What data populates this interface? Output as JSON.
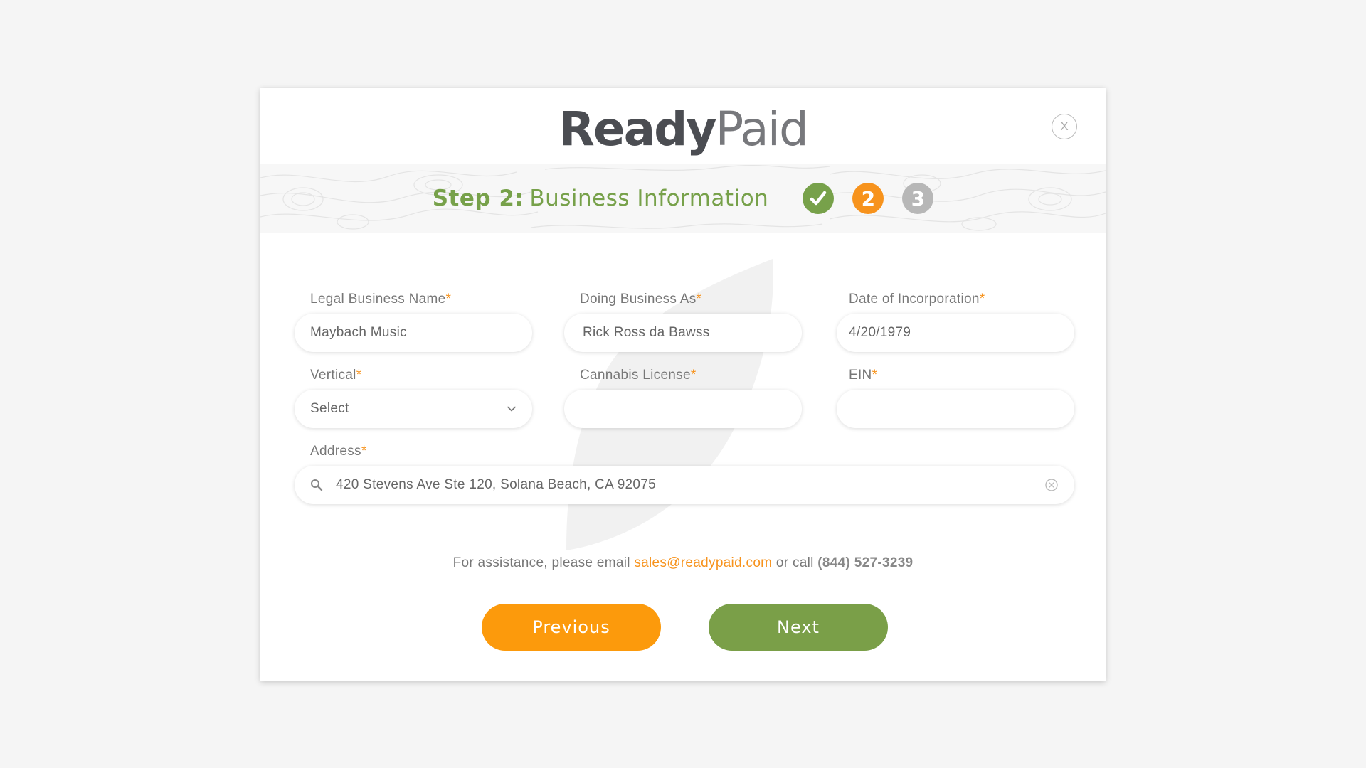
{
  "brand": {
    "word1": "Ready",
    "word2": "Paid"
  },
  "close_label": "X",
  "step": {
    "prefix": "Step 2:",
    "title": "Business Information",
    "indicators": [
      {
        "label": "",
        "state": "done",
        "icon": "check-icon"
      },
      {
        "label": "2",
        "state": "current"
      },
      {
        "label": "3",
        "state": "upcoming"
      }
    ]
  },
  "required_marker": "*",
  "form": {
    "legal_name": {
      "label": "Legal Business Name",
      "value": "Maybach Music"
    },
    "dba": {
      "label": "Doing Business As",
      "value": "Rick Ross da Bawss"
    },
    "incorporation_date": {
      "label": "Date of Incorporation",
      "value": "4/20/1979"
    },
    "vertical": {
      "label": "Vertical",
      "value": "Select"
    },
    "cannabis_license": {
      "label": "Cannabis License",
      "value": ""
    },
    "ein": {
      "label": "EIN",
      "value": ""
    },
    "address": {
      "label": "Address",
      "value": "420 Stevens Ave Ste 120, Solana Beach, CA 92075"
    }
  },
  "assist": {
    "prefix": "For assistance, please email",
    "email": "sales@readypaid.com",
    "middle": "or call",
    "phone": "(844) 527-3239"
  },
  "buttons": {
    "previous": "Previous",
    "next": "Next"
  },
  "colors": {
    "brand_green": "#77a14a",
    "brand_orange": "#f7931d",
    "inactive_gray": "#b7b7b7",
    "logo_dark": "#4b4d52"
  }
}
